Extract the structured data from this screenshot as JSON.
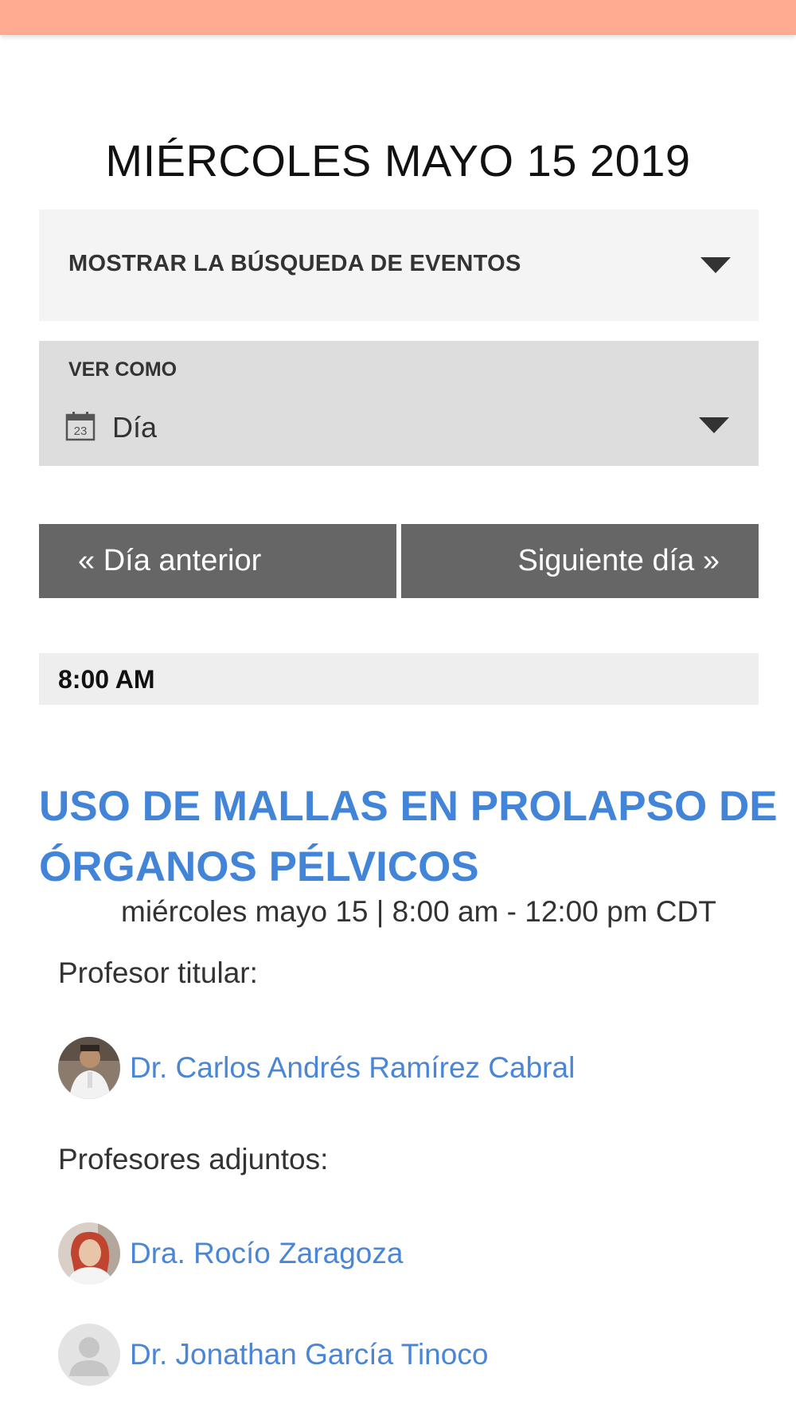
{
  "header": {
    "date_title": "MIÉRCOLES MAYO 15 2019"
  },
  "search": {
    "toggle_label": "MOSTRAR LA BÚSQUEDA DE EVENTOS"
  },
  "view": {
    "label": "VER COMO",
    "selected": "Día",
    "calendar_icon_day": "23"
  },
  "nav": {
    "prev_label": "« Día anterior",
    "next_label": "Siguiente día »"
  },
  "time_slot": {
    "label": "8:00 AM"
  },
  "event": {
    "title": "USO DE MALLAS EN PROLAPSO DE ÓRGANOS PÉLVICOS",
    "datetime": "miércoles mayo 15 | 8:00 am - 12:00 pm CDT",
    "lead_label": "Profesor titular:",
    "lead": {
      "name": "Dr. Carlos Andrés Ramírez Cabral"
    },
    "adjuncts_label": "Profesores adjuntos:",
    "adjuncts": [
      {
        "name": "Dra. Rocío Zaragoza"
      },
      {
        "name": "Dr. Jonathan García Tinoco"
      }
    ]
  },
  "colors": {
    "top_bar": "#ffab91",
    "link_blue": "#4285d8",
    "nav_button_bg": "#666666"
  }
}
